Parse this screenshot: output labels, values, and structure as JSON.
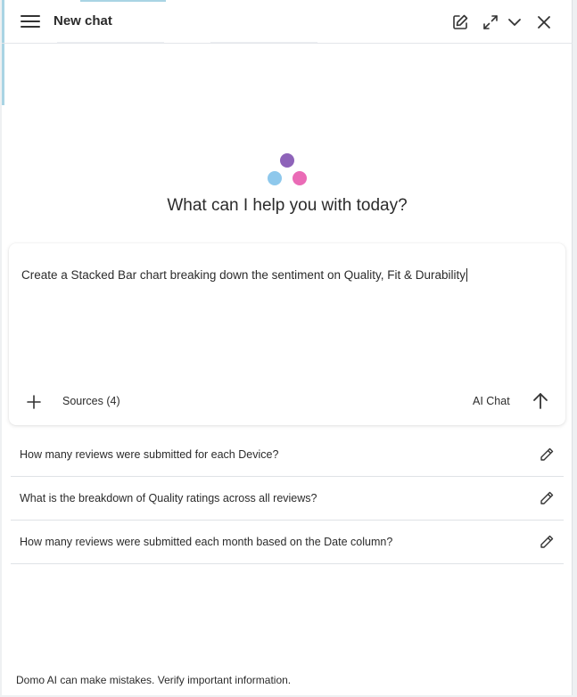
{
  "header": {
    "title": "New chat",
    "icons": [
      "hamburger-menu-icon",
      "new-chat-icon",
      "expand-icon",
      "chevron-down-icon",
      "close-icon"
    ]
  },
  "colors": {
    "dot_purple": "#8e63b9",
    "dot_blue": "#8ec8ec",
    "dot_pink": "#ea6bb6",
    "accent_blue": "#a9d4e4"
  },
  "main": {
    "greeting": "What can I help you with today?"
  },
  "composer": {
    "prompt_text": "Create a Stacked Bar chart breaking down the sentiment on Quality, Fit & Durability",
    "sources_label": "Sources (4)",
    "mode_label": "AI Chat"
  },
  "suggestions": [
    {
      "text": "How many reviews were submitted for each Device?"
    },
    {
      "text": "What is the breakdown of Quality ratings across all reviews?"
    },
    {
      "text": "How many reviews were submitted each month based on the Date column?"
    }
  ],
  "footer": {
    "disclaimer": "Domo AI can make mistakes. Verify important information."
  }
}
